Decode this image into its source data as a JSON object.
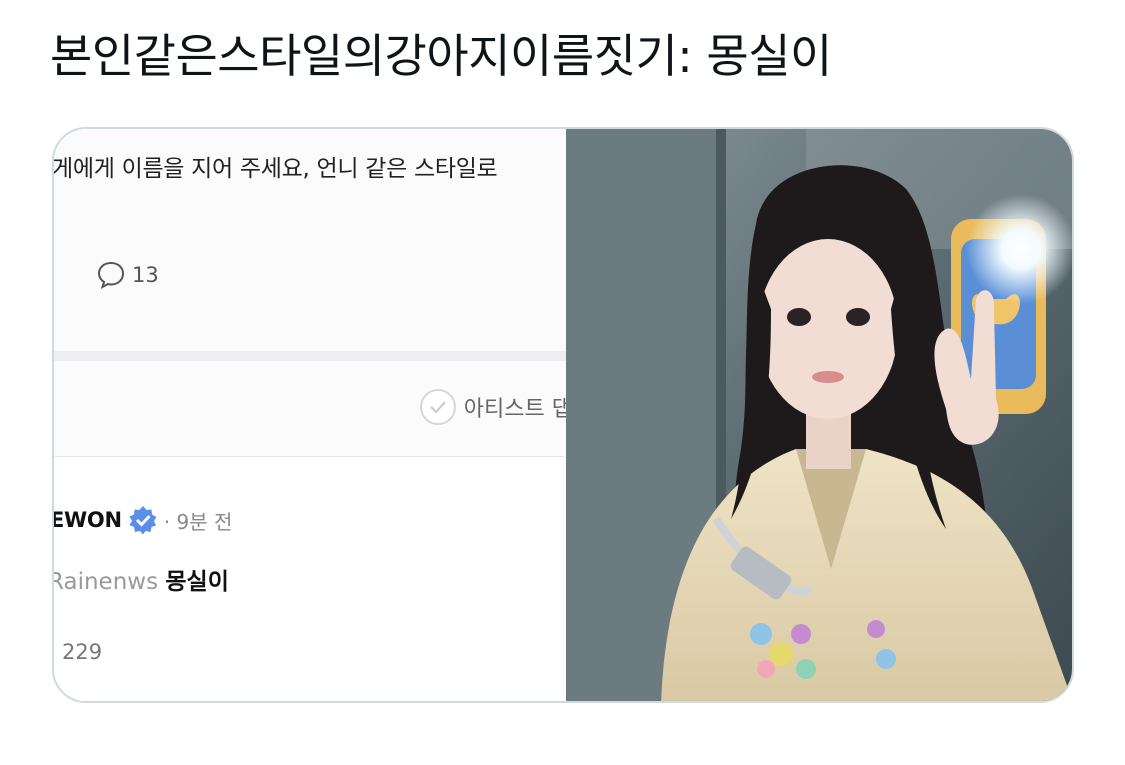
{
  "tweet": {
    "text": "본인같은스타일의강아지이름짓기: 몽실이"
  },
  "media": {
    "left": {
      "question": "게에게 이름을 지어 주세요, 언니 같은 스타일로",
      "comment_count": "13",
      "filter_label": "아티스트 댑",
      "reply_author": "EWON",
      "reply_time": "· 9분 전",
      "reply_mention": "Rainenws",
      "reply_text": "몽실이",
      "like_count": "229"
    },
    "right": {
      "photo_alt_icon": "mirror-selfie-photo"
    }
  },
  "colors": {
    "card_border": "#cfd9de",
    "verified": "#5b8ee6",
    "text_primary": "#0f1419"
  }
}
